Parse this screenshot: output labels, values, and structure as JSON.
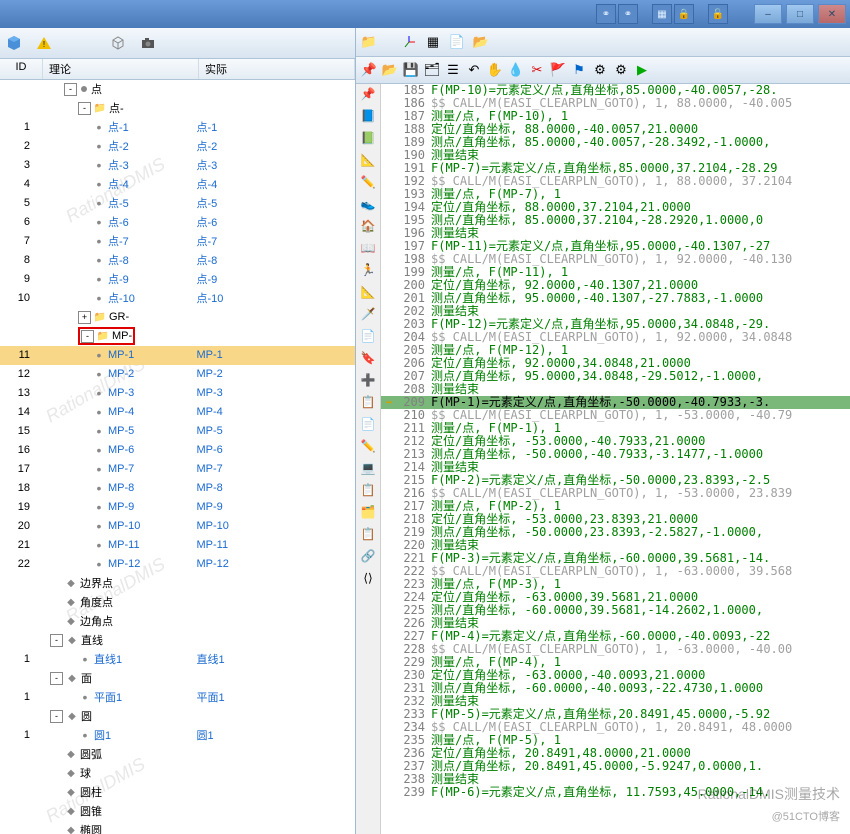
{
  "titlebar": {
    "icons": [
      "link-icon",
      "link2-icon",
      "grid-icon",
      "lock-icon",
      "lock2-icon"
    ],
    "win": [
      "‒",
      "□",
      "✕"
    ]
  },
  "left_toolbar": [
    "cube-blue",
    "triangle-warn",
    "cube-wire",
    "camera"
  ],
  "headers": {
    "id": "ID",
    "theory": "理论",
    "actual": "实际"
  },
  "tree": [
    {
      "lvl": 2,
      "exp": "-",
      "ico": "dot",
      "th": "点",
      "ac": ""
    },
    {
      "lvl": 3,
      "exp": "-",
      "ico": "folder",
      "th": "点-",
      "ac": ""
    },
    {
      "id": "1",
      "lvl": 4,
      "ico": "pt",
      "th": "点-1",
      "link": 1,
      "ac": "点-1"
    },
    {
      "id": "2",
      "lvl": 4,
      "ico": "pt",
      "th": "点-2",
      "link": 1,
      "ac": "点-2"
    },
    {
      "id": "3",
      "lvl": 4,
      "ico": "pt",
      "th": "点-3",
      "link": 1,
      "ac": "点-3"
    },
    {
      "id": "4",
      "lvl": 4,
      "ico": "pt",
      "th": "点-4",
      "link": 1,
      "ac": "点-4"
    },
    {
      "id": "5",
      "lvl": 4,
      "ico": "pt",
      "th": "点-5",
      "link": 1,
      "ac": "点-5"
    },
    {
      "id": "6",
      "lvl": 4,
      "ico": "pt",
      "th": "点-6",
      "link": 1,
      "ac": "点-6"
    },
    {
      "id": "7",
      "lvl": 4,
      "ico": "pt",
      "th": "点-7",
      "link": 1,
      "ac": "点-7"
    },
    {
      "id": "8",
      "lvl": 4,
      "ico": "pt",
      "th": "点-8",
      "link": 1,
      "ac": "点-8"
    },
    {
      "id": "9",
      "lvl": 4,
      "ico": "pt",
      "th": "点-9",
      "link": 1,
      "ac": "点-9"
    },
    {
      "id": "10",
      "lvl": 4,
      "ico": "pt",
      "th": "点-10",
      "link": 1,
      "ac": "点-10"
    },
    {
      "lvl": 3,
      "exp": "+",
      "ico": "folder",
      "th": "GR-",
      "ac": ""
    },
    {
      "lvl": 3,
      "exp": "-",
      "ico": "folder",
      "th": "MP-",
      "ac": "",
      "redbox": true
    },
    {
      "id": "11",
      "lvl": 4,
      "ico": "pt",
      "th": "MP-1",
      "link": 1,
      "ac": "MP-1",
      "sel": true
    },
    {
      "id": "12",
      "lvl": 4,
      "ico": "pt",
      "th": "MP-2",
      "link": 1,
      "ac": "MP-2"
    },
    {
      "id": "13",
      "lvl": 4,
      "ico": "pt",
      "th": "MP-3",
      "link": 1,
      "ac": "MP-3"
    },
    {
      "id": "14",
      "lvl": 4,
      "ico": "pt",
      "th": "MP-4",
      "link": 1,
      "ac": "MP-4"
    },
    {
      "id": "15",
      "lvl": 4,
      "ico": "pt",
      "th": "MP-5",
      "link": 1,
      "ac": "MP-5"
    },
    {
      "id": "16",
      "lvl": 4,
      "ico": "pt",
      "th": "MP-6",
      "link": 1,
      "ac": "MP-6"
    },
    {
      "id": "17",
      "lvl": 4,
      "ico": "pt",
      "th": "MP-7",
      "link": 1,
      "ac": "MP-7"
    },
    {
      "id": "18",
      "lvl": 4,
      "ico": "pt",
      "th": "MP-8",
      "link": 1,
      "ac": "MP-8"
    },
    {
      "id": "19",
      "lvl": 4,
      "ico": "pt",
      "th": "MP-9",
      "link": 1,
      "ac": "MP-9"
    },
    {
      "id": "20",
      "lvl": 4,
      "ico": "pt",
      "th": "MP-10",
      "link": 1,
      "ac": "MP-10"
    },
    {
      "id": "21",
      "lvl": 4,
      "ico": "pt",
      "th": "MP-11",
      "link": 1,
      "ac": "MP-11"
    },
    {
      "id": "22",
      "lvl": 4,
      "ico": "pt",
      "th": "MP-12",
      "link": 1,
      "ac": "MP-12"
    },
    {
      "lvl": 2,
      "ico": "shape",
      "th": "边界点",
      "ac": ""
    },
    {
      "lvl": 2,
      "ico": "shape",
      "th": "角度点",
      "ac": ""
    },
    {
      "lvl": 2,
      "ico": "shape",
      "th": "边角点",
      "ac": ""
    },
    {
      "lvl": 1,
      "exp": "-",
      "ico": "shape",
      "th": "直线",
      "ac": ""
    },
    {
      "id": "1",
      "lvl": 3,
      "ico": "pt",
      "th": "直线1",
      "link": 1,
      "ac": "直线1"
    },
    {
      "lvl": 1,
      "exp": "-",
      "ico": "shape",
      "th": "面",
      "ac": ""
    },
    {
      "id": "1",
      "lvl": 3,
      "ico": "pt",
      "th": "平面1",
      "link": 1,
      "ac": "平面1"
    },
    {
      "lvl": 1,
      "exp": "-",
      "ico": "shape",
      "th": "圆",
      "ac": ""
    },
    {
      "id": "1",
      "lvl": 3,
      "ico": "pt",
      "th": "圆1",
      "link": 1,
      "ac": "圆1"
    },
    {
      "lvl": 2,
      "ico": "shape",
      "th": "圆弧",
      "ac": ""
    },
    {
      "lvl": 2,
      "ico": "shape",
      "th": "球",
      "ac": ""
    },
    {
      "lvl": 2,
      "ico": "shape",
      "th": "圆柱",
      "ac": ""
    },
    {
      "lvl": 2,
      "ico": "shape",
      "th": "圆锥",
      "ac": ""
    },
    {
      "lvl": 2,
      "ico": "shape",
      "th": "椭圆",
      "ac": ""
    }
  ],
  "right_toolbar1": [
    "folder",
    "axes",
    "grid",
    "document",
    "yellow-folder"
  ],
  "right_toolbar2": [
    "pin",
    "open",
    "save",
    "tree",
    "indent",
    "undo",
    "hand",
    "drop",
    "cut",
    "flag",
    "flag2",
    "gear",
    "gear2",
    "play"
  ],
  "gutter_icons": [
    "📌",
    "📘",
    "📗",
    "📐",
    "✏️",
    "👟",
    "🏠",
    "📖",
    "🏃",
    "📐",
    "🗡️",
    "📄",
    "🔖",
    "➕",
    "📋",
    "📄",
    "✏️",
    "💻",
    "📋",
    "🗂️",
    "📋",
    "🔗",
    "⟨⟩"
  ],
  "code": [
    {
      "n": 185,
      "t": "F(MP-10)=元素定义/点,直角坐标,85.0000,-40.0057,-28."
    },
    {
      "n": 186,
      "t": "$$ CALL/M(EASI_CLEARPLN_GOTO), 1, 88.0000, -40.005",
      "gray": 1
    },
    {
      "n": 187,
      "t": "测量/点, F(MP-10), 1"
    },
    {
      "n": 188,
      "t": "  定位/直角坐标, 88.0000,-40.0057,21.0000"
    },
    {
      "n": 189,
      "t": "  测点/直角坐标, 85.0000,-40.0057,-28.3492,-1.0000,"
    },
    {
      "n": 190,
      "t": "测量结束"
    },
    {
      "n": 191,
      "t": "F(MP-7)=元素定义/点,直角坐标,85.0000,37.2104,-28.29"
    },
    {
      "n": 192,
      "t": "$$ CALL/M(EASI_CLEARPLN_GOTO), 1, 88.0000, 37.2104",
      "gray": 1
    },
    {
      "n": 193,
      "t": "测量/点, F(MP-7), 1"
    },
    {
      "n": 194,
      "t": "  定位/直角坐标, 88.0000,37.2104,21.0000"
    },
    {
      "n": 195,
      "t": "  测点/直角坐标, 85.0000,37.2104,-28.2920,1.0000,0"
    },
    {
      "n": 196,
      "t": "测量结束"
    },
    {
      "n": 197,
      "t": "F(MP-11)=元素定义/点,直角坐标,95.0000,-40.1307,-27"
    },
    {
      "n": 198,
      "t": "$$ CALL/M(EASI_CLEARPLN_GOTO), 1, 92.0000, -40.130",
      "gray": 1
    },
    {
      "n": 199,
      "t": "测量/点, F(MP-11), 1"
    },
    {
      "n": 200,
      "t": "  定位/直角坐标, 92.0000,-40.1307,21.0000"
    },
    {
      "n": 201,
      "t": "  测点/直角坐标, 95.0000,-40.1307,-27.7883,-1.0000"
    },
    {
      "n": 202,
      "t": "测量结束"
    },
    {
      "n": 203,
      "t": "F(MP-12)=元素定义/点,直角坐标,95.0000,34.0848,-29."
    },
    {
      "n": 204,
      "t": "$$ CALL/M(EASI_CLEARPLN_GOTO), 1, 92.0000, 34.0848",
      "gray": 1
    },
    {
      "n": 205,
      "t": "测量/点, F(MP-12), 1"
    },
    {
      "n": 206,
      "t": "  定位/直角坐标, 92.0000,34.0848,21.0000"
    },
    {
      "n": 207,
      "t": "  测点/直角坐标, 95.0000,34.0848,-29.5012,-1.0000,"
    },
    {
      "n": 208,
      "t": "测量结束"
    },
    {
      "n": 209,
      "t": "F(MP-1)=元素定义/点,直角坐标,-50.0000,-40.7933,-3.",
      "cur": 1
    },
    {
      "n": 210,
      "t": "$$ CALL/M(EASI_CLEARPLN_GOTO), 1, -53.0000, -40.79",
      "gray": 1
    },
    {
      "n": 211,
      "t": "测量/点, F(MP-1), 1"
    },
    {
      "n": 212,
      "t": "  定位/直角坐标, -53.0000,-40.7933,21.0000"
    },
    {
      "n": 213,
      "t": "  测点/直角坐标, -50.0000,-40.7933,-3.1477,-1.0000"
    },
    {
      "n": 214,
      "t": "测量结束"
    },
    {
      "n": 215,
      "t": "F(MP-2)=元素定义/点,直角坐标,-50.0000,23.8393,-2.5"
    },
    {
      "n": 216,
      "t": "$$ CALL/M(EASI_CLEARPLN_GOTO), 1, -53.0000, 23.839",
      "gray": 1
    },
    {
      "n": 217,
      "t": "测量/点, F(MP-2), 1"
    },
    {
      "n": 218,
      "t": "  定位/直角坐标, -53.0000,23.8393,21.0000"
    },
    {
      "n": 219,
      "t": "  测点/直角坐标, -50.0000,23.8393,-2.5827,-1.0000,"
    },
    {
      "n": 220,
      "t": "测量结束"
    },
    {
      "n": 221,
      "t": "F(MP-3)=元素定义/点,直角坐标,-60.0000,39.5681,-14."
    },
    {
      "n": 222,
      "t": "$$ CALL/M(EASI_CLEARPLN_GOTO), 1, -63.0000, 39.568",
      "gray": 1
    },
    {
      "n": 223,
      "t": "测量/点, F(MP-3), 1"
    },
    {
      "n": 224,
      "t": "  定位/直角坐标, -63.0000,39.5681,21.0000"
    },
    {
      "n": 225,
      "t": "  测点/直角坐标, -60.0000,39.5681,-14.2602,1.0000,"
    },
    {
      "n": 226,
      "t": "测量结束"
    },
    {
      "n": 227,
      "t": "F(MP-4)=元素定义/点,直角坐标,-60.0000,-40.0093,-22"
    },
    {
      "n": 228,
      "t": "$$ CALL/M(EASI_CLEARPLN_GOTO), 1, -63.0000, -40.00",
      "gray": 1
    },
    {
      "n": 229,
      "t": "测量/点, F(MP-4), 1"
    },
    {
      "n": 230,
      "t": "  定位/直角坐标, -63.0000,-40.0093,21.0000"
    },
    {
      "n": 231,
      "t": "  测点/直角坐标, -60.0000,-40.0093,-22.4730,1.0000"
    },
    {
      "n": 232,
      "t": "测量结束"
    },
    {
      "n": 233,
      "t": "F(MP-5)=元素定义/点,直角坐标,20.8491,45.0000,-5.92"
    },
    {
      "n": 234,
      "t": "$$ CALL/M(EASI_CLEARPLN_GOTO), 1, 20.8491, 48.0000",
      "gray": 1
    },
    {
      "n": 235,
      "t": "测量/点, F(MP-5), 1"
    },
    {
      "n": 236,
      "t": "  定位/直角坐标, 20.8491,48.0000,21.0000"
    },
    {
      "n": 237,
      "t": "  测点/直角坐标, 20.8491,45.0000,-5.9247,0.0000,1."
    },
    {
      "n": 238,
      "t": "测量结束"
    },
    {
      "n": 239,
      "t": "F(MP-6)=元素定义/点,直角坐标, 11.7593,45.0000,-14."
    }
  ],
  "watermark": "RationalDMIS",
  "wm_bottom": "RationalDMIS测量技术",
  "wm_blog": "@51CTO博客"
}
